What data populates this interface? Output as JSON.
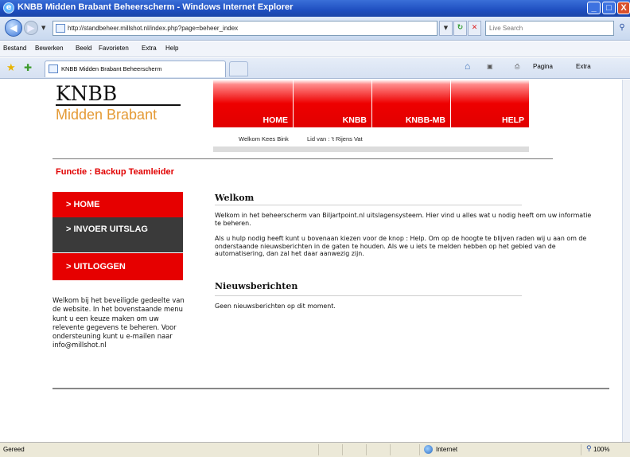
{
  "window": {
    "title": "KNBB Midden Brabant Beheerscherm - Windows Internet Explorer",
    "minimize": "_",
    "maximize": "□",
    "close": "X"
  },
  "toolbar": {
    "url": "http://standbeheer.millshot.nl/index.php?page=beheer_index",
    "search_placeholder": "Live Search"
  },
  "menu": {
    "items": [
      "Bestand",
      "Bewerken",
      "Beeld",
      "Favorieten",
      "Extra",
      "Help"
    ]
  },
  "tabs": {
    "active_label": "KNBB Midden Brabant Beheerscherm"
  },
  "commandbar": {
    "page_label": "Pagina",
    "extra_label": "Extra"
  },
  "site": {
    "logo_top": "KNBB",
    "logo_bottom": "Midden Brabant",
    "nav": [
      "HOME",
      "KNBB",
      "KNBB-MB",
      "HELP"
    ],
    "welcome_user": "Welkom Kees Bink",
    "member_of": "Lid van : 't Rijens Vat",
    "functie": "Functie : Backup Teamleider",
    "sidemenu": [
      "> HOME",
      "> INVOER UITSLAG",
      "> UITLOGGEN"
    ],
    "sidetext": "Welkom bij het beveiligde gedeelte van de website. In het bovenstaande menu kunt u een keuze maken om uw relevente gegevens te beheren. Voor ondersteuning kunt u e-mailen naar info@millshot.nl",
    "welkom_heading": "Welkom",
    "welkom_p1": "Welkom in het beheerscherm van Biljartpoint.nl uitslagensysteem. Hier vind u alles wat u nodig heeft om uw informatie te beheren.",
    "welkom_p2": "Als u hulp nodig heeft kunt u bovenaan kiezen voor de knop : Help. Om op de hoogte te blijven raden wij u aan om de onderstaande nieuwsberichten in de gaten te houden. Als we u iets te melden hebben op het gebied van de automatisering, dan zal het daar aanwezig zijn.",
    "nieuws_heading": "Nieuwsberichten",
    "nieuws_text": "Geen nieuwsberichten op dit moment."
  },
  "status": {
    "text": "Gereed",
    "zone": "Internet",
    "zoom": "100%"
  },
  "colors": {
    "brand_red": "#e60000",
    "logo_orange": "#e49a35",
    "menu_dark": "#3a3a3a"
  }
}
